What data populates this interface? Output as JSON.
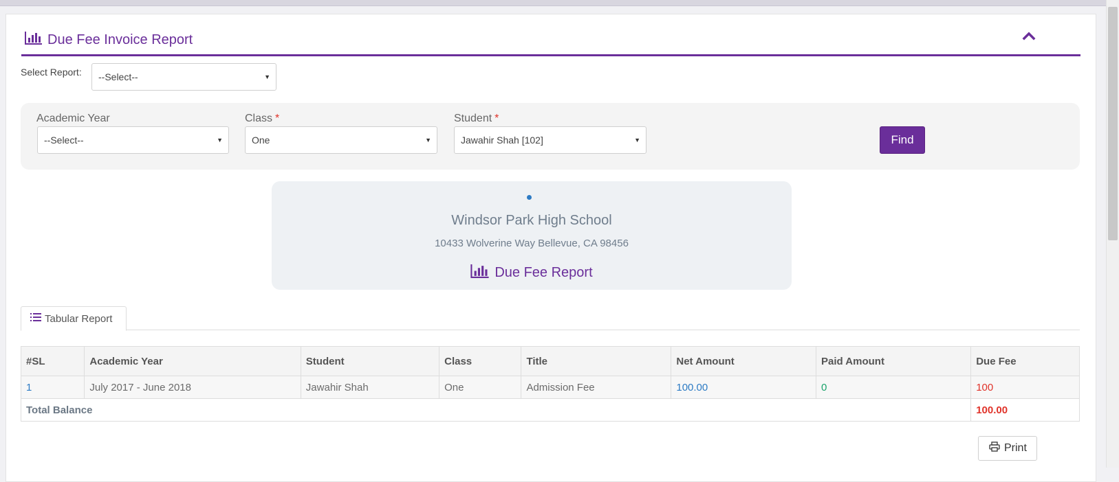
{
  "panel": {
    "title": "Due Fee Invoice Report",
    "collapse_icon": "chevron-up-icon"
  },
  "select_report": {
    "label": "Select Report:",
    "value": "--Select--"
  },
  "filters": {
    "academic_year": {
      "label": "Academic Year",
      "value": "--Select--"
    },
    "class": {
      "label": "Class",
      "required": "*",
      "value": "One"
    },
    "student": {
      "label": "Student",
      "required": "*",
      "value": "Jawahir Shah [102]"
    },
    "find_label": "Find"
  },
  "school": {
    "name": "Windsor Park High School",
    "address": "10433 Wolverine Way Bellevue, CA 98456",
    "report_title": "Due Fee Report"
  },
  "tabs": [
    {
      "label": "Tabular Report",
      "icon": "list-icon",
      "active": true
    }
  ],
  "table": {
    "headers": [
      "#SL",
      "Academic Year",
      "Student",
      "Class",
      "Title",
      "Net Amount",
      "Paid Amount",
      "Due Fee"
    ],
    "rows": [
      {
        "sl": "1",
        "academic_year": "July 2017 - June 2018",
        "student": "Jawahir Shah",
        "class": "One",
        "title": "Admission Fee",
        "net_amount": "100.00",
        "paid_amount": "0",
        "due_fee": "100"
      }
    ],
    "total": {
      "label": "Total Balance",
      "value": "100.00"
    }
  },
  "print_label": "Print",
  "colors": {
    "accent": "#6a2e9a",
    "blue": "#2d7bc4",
    "green": "#1aa36b",
    "red": "#e0332a"
  }
}
